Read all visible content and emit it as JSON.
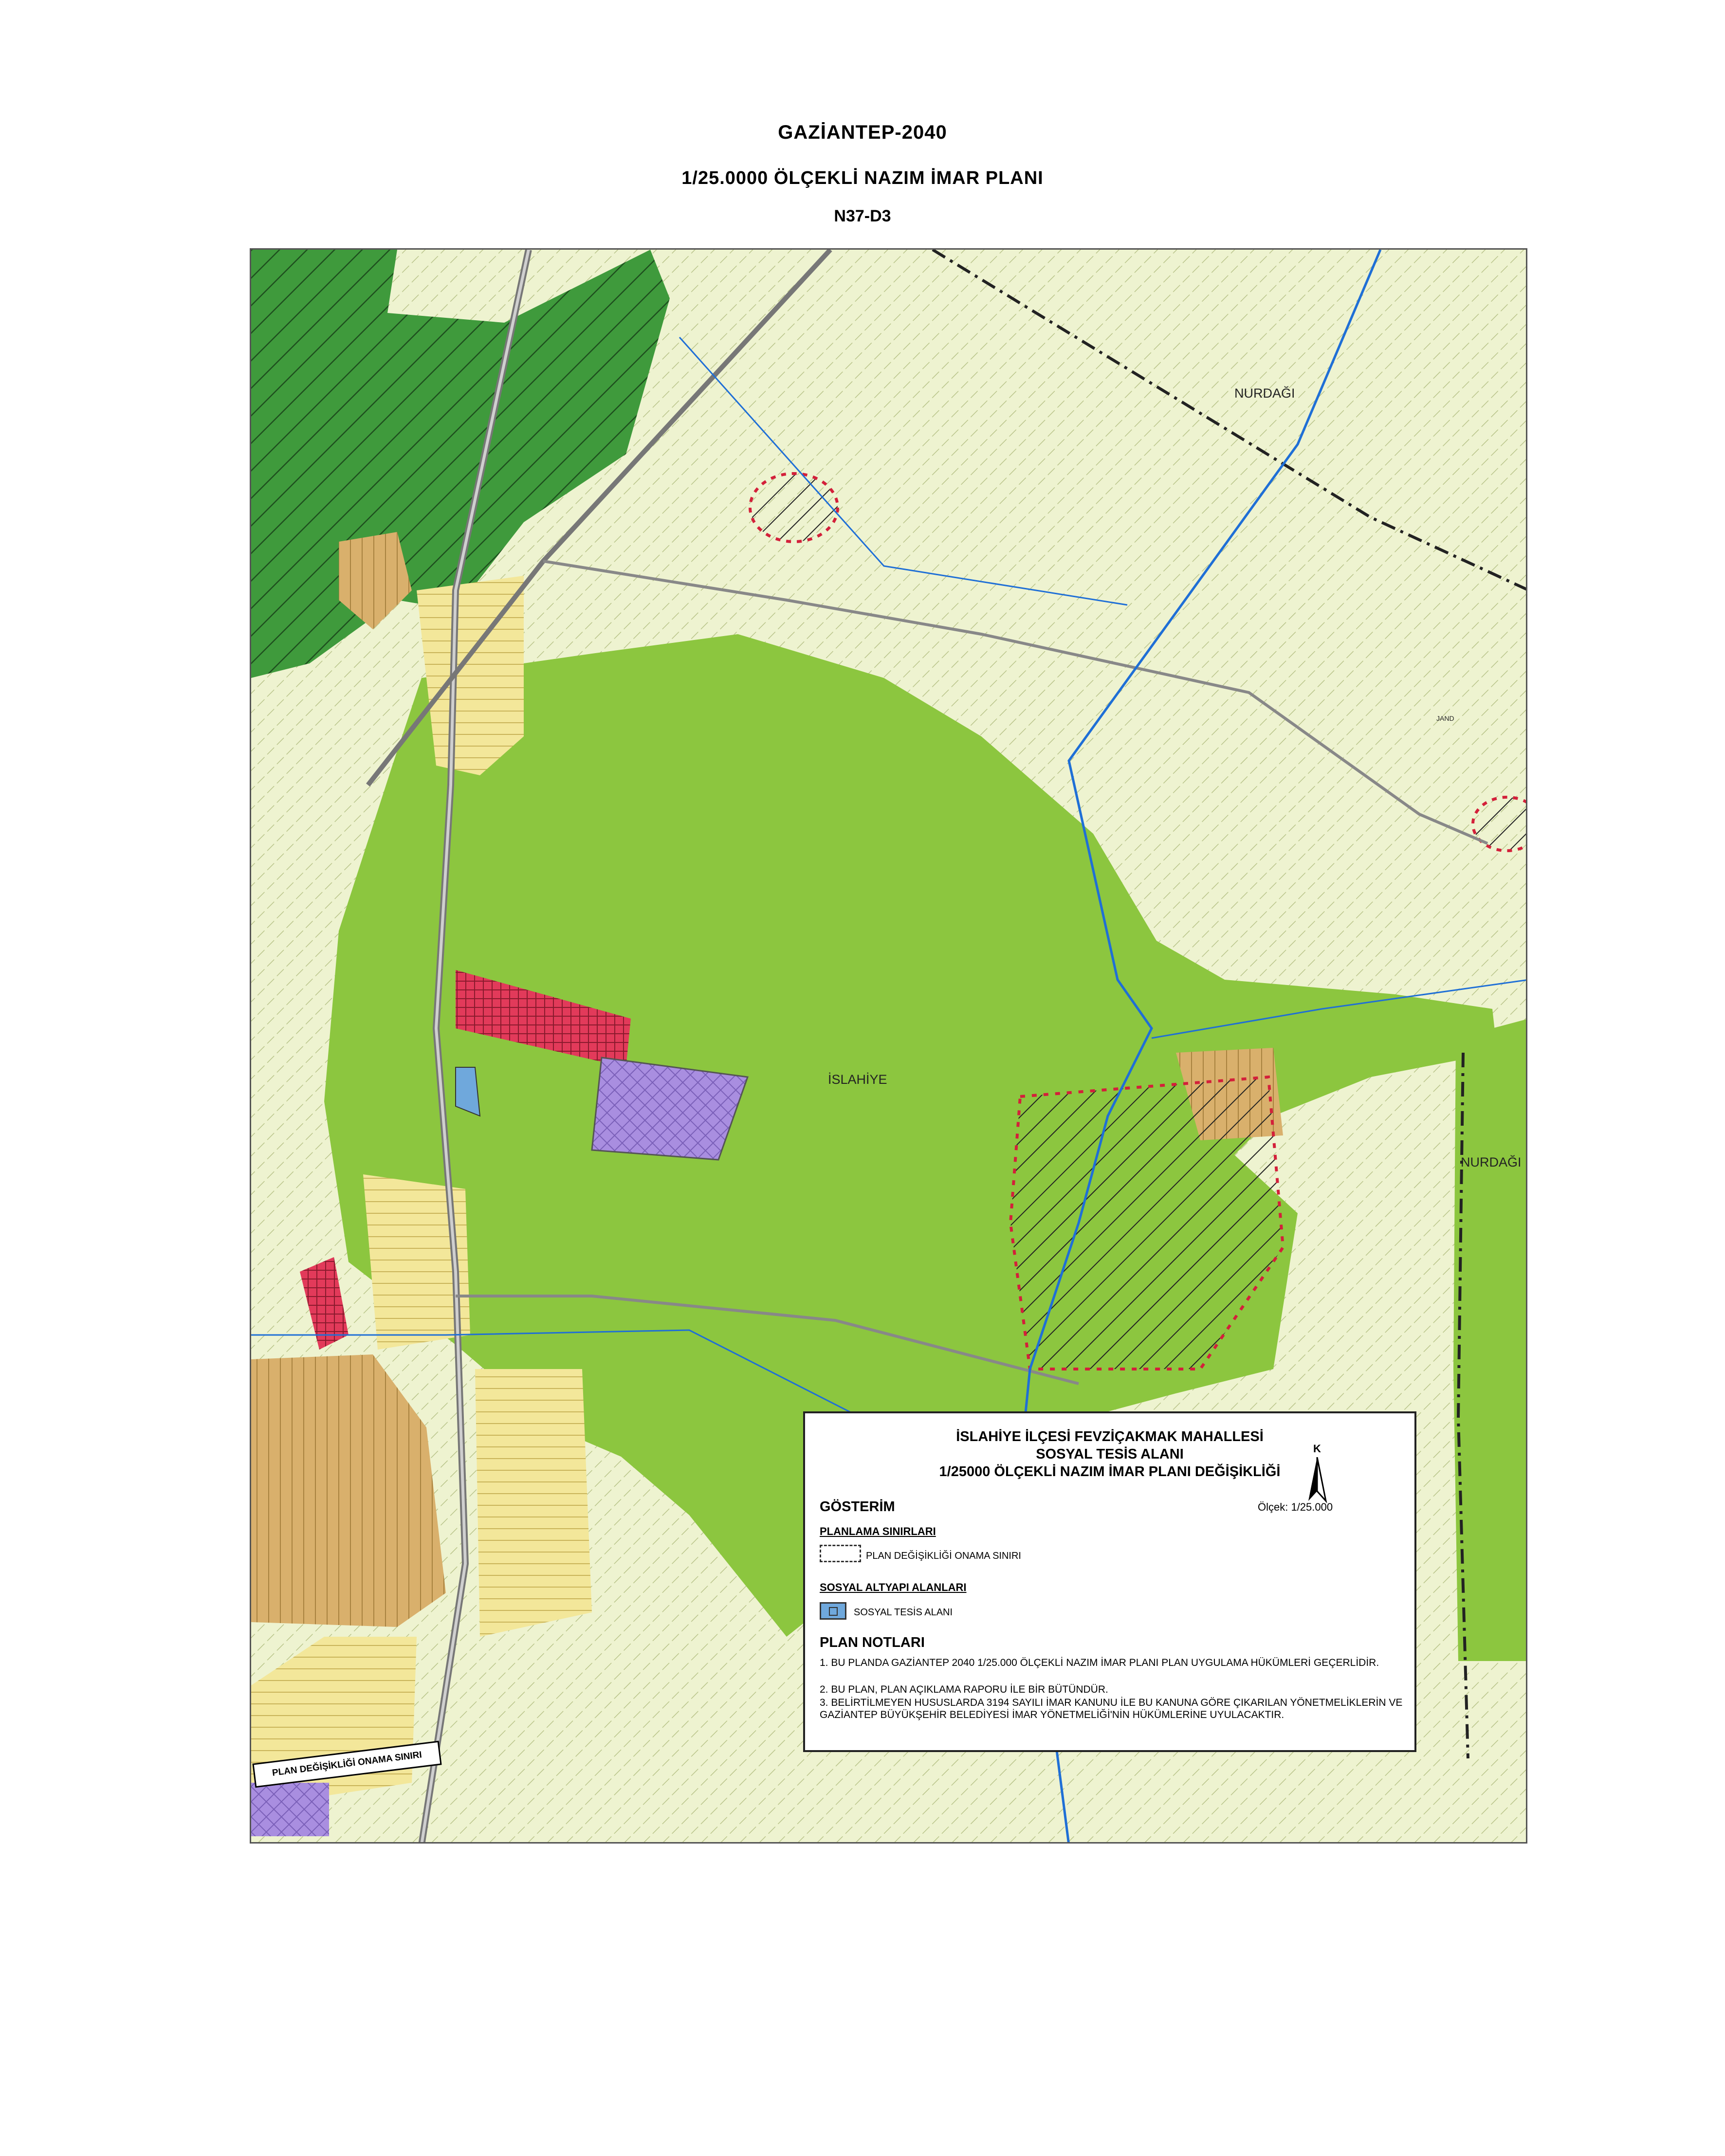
{
  "header": {
    "title": "GAZİANTEP-2040",
    "subtitle": "1/25.0000 ÖLÇEKLİ NAZIM İMAR PLANI",
    "sheet": "N37-D3"
  },
  "map": {
    "labels": {
      "nurdagi_top": "NURDAĞI",
      "nurdagi_right": "NURDAĞI",
      "islahiye": "İSLAHİYE",
      "jandarma": "JAND"
    },
    "stamp": "PLAN DEĞİŞİKLİĞİ ONAMA SINIRI",
    "colors": {
      "agriculture": "#eef3d0",
      "forest": "#8cc63f",
      "dark_forest": "#3f9a3c",
      "residential": "#f3e79a",
      "settlement_brown": "#d9b06c",
      "commercial": "#e23a5a",
      "industrial": "#a98ee0",
      "social_facility": "#6fa8dc",
      "river": "#1f6fd6",
      "road": "#8a8a8a"
    }
  },
  "legend": {
    "title_lines": [
      "İSLAHİYE İLÇESİ FEVZİÇAKMAK MAHALLESİ",
      "SOSYAL TESİS ALANI",
      "1/25000 ÖLÇEKLİ NAZIM İMAR PLANI DEĞİŞİKLİĞİ"
    ],
    "north_letter": "K",
    "scale": "Ölçek: 1/25.000",
    "gosterim": "GÖSTERİM",
    "planning_heading": "PLANLAMA SINIRLARI",
    "planning_item": "PLAN DEĞİŞİKLİĞİ ONAMA SINIRI",
    "social_heading": "SOSYAL ALTYAPI ALANLARI",
    "social_item": "SOSYAL TESİS ALANI",
    "notes_heading": "PLAN NOTLARI",
    "notes": [
      "1. BU PLANDA GAZİANTEP 2040 1/25.000 ÖLÇEKLİ NAZIM İMAR PLANI PLAN UYGULAMA HÜKÜMLERİ GEÇERLİDİR.",
      "2. BU PLAN, PLAN AÇIKLAMA RAPORU İLE BİR BÜTÜNDÜR.",
      "3. BELİRTİLMEYEN HUSUSLARDA 3194 SAYILI İMAR KANUNU İLE BU KANUNA GÖRE ÇIKARILAN YÖNETMELİKLERİN VE GAZİANTEP BÜYÜKŞEHİR BELEDİYESİ İMAR YÖNETMELİĞİ'NİN HÜKÜMLERİNE UYULACAKTIR."
    ]
  }
}
